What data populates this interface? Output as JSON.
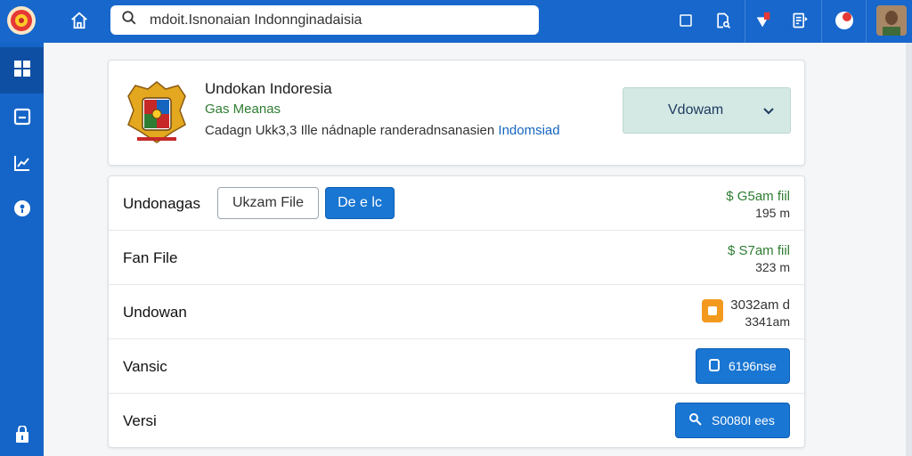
{
  "topbar": {
    "search": {
      "value": "mdoit.Isnonaian Indonnginadaisia",
      "icon": "search-icon"
    },
    "icons": [
      "home-icon",
      "folder-icon",
      "file-search-icon",
      "flag-icon",
      "document-icon",
      "notification-icon"
    ],
    "accent": "#1767cc"
  },
  "sidebar": {
    "items": [
      "dashboard-icon",
      "card-icon",
      "chart-icon",
      "help-icon",
      "lock-icon"
    ]
  },
  "header": {
    "title": "Undokan Indoresia",
    "subtitle": "Gas Meanas",
    "description_prefix": "Cadagn Ukk3,3 Ille nádnaple randeradnsanasien",
    "description_link": "Indomsiad",
    "dropdown_value": "Vdowam"
  },
  "rows": [
    {
      "label": "Undonagas",
      "button_outline": "Ukzam File",
      "button_primary": "De e lc",
      "value": "$ G5am fiil",
      "sub": "195 m"
    },
    {
      "label": "Fan File",
      "value": "$ S7am fiil",
      "sub": "323 m"
    },
    {
      "label": "Undowan",
      "value": "3032am d",
      "sub": "3341am"
    },
    {
      "label": "Vansic",
      "button": "6196nse"
    },
    {
      "label": "Versi",
      "button": "S0080I ees"
    }
  ],
  "colors": {
    "green": "#2e7d32",
    "blue": "#1976d2",
    "orange": "#f39a1e"
  }
}
